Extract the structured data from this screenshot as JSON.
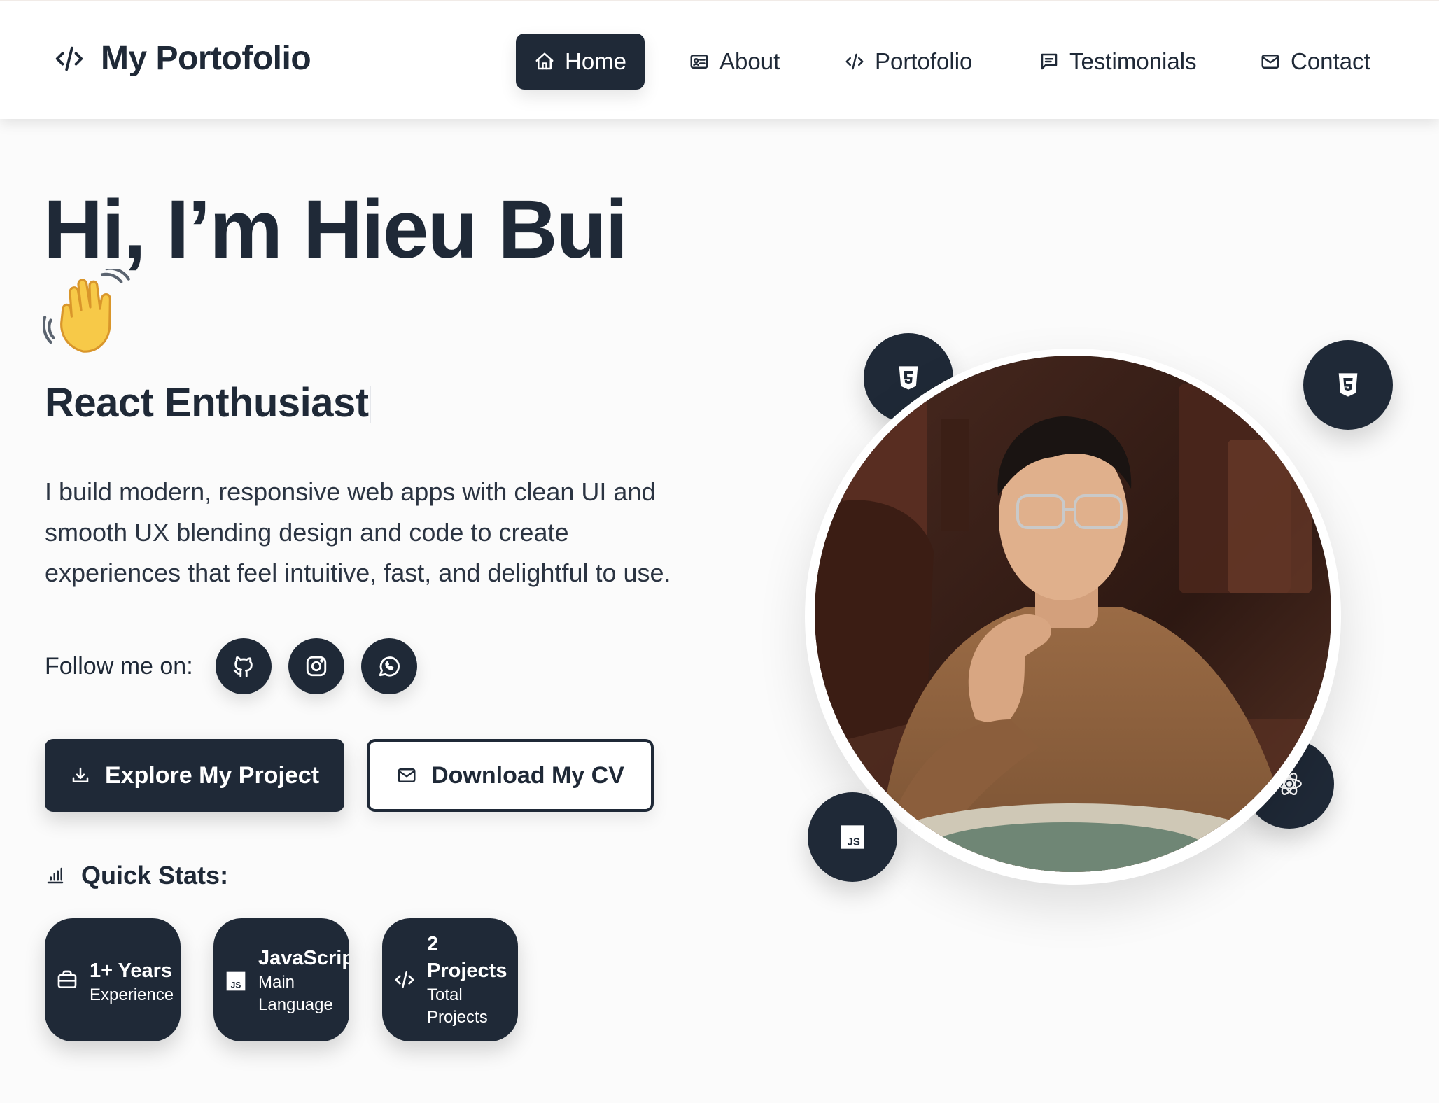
{
  "nav": {
    "brand": "My Portofolio",
    "items": [
      {
        "label": "Home",
        "icon": "home-icon",
        "active": true
      },
      {
        "label": "About",
        "icon": "id-card-icon",
        "active": false
      },
      {
        "label": "Portofolio",
        "icon": "code-icon",
        "active": false
      },
      {
        "label": "Testimonials",
        "icon": "message-icon",
        "active": false
      },
      {
        "label": "Contact",
        "icon": "mail-icon",
        "active": false
      }
    ]
  },
  "hero": {
    "title": "Hi, I’m Hieu Bui",
    "subtitle": "React Enthusiast",
    "description": "I build modern, responsive web apps with clean UI and smooth UX blending design and code to create experiences that feel intuitive, fast, and delightful to use.",
    "follow_label": "Follow me on:",
    "socials": [
      "github-icon",
      "instagram-icon",
      "whatsapp-icon"
    ],
    "primary_button": "Explore My Project",
    "secondary_button": "Download My CV"
  },
  "stats": {
    "title": "Quick Stats:",
    "items": [
      {
        "value": "1+ Years",
        "label": "Experience",
        "icon": "briefcase-icon"
      },
      {
        "value": "JavaScript",
        "label": "Main Language",
        "icon": "js-icon"
      },
      {
        "value": "2 Projects",
        "label": "Total Projects",
        "icon": "code-icon"
      }
    ]
  },
  "tech_badges": [
    "html5-icon",
    "css3-icon",
    "js-icon",
    "react-icon"
  ],
  "colors": {
    "primary": "#1f2937",
    "background": "#fbfbfb",
    "text": "#1f2937",
    "white": "#ffffff"
  }
}
